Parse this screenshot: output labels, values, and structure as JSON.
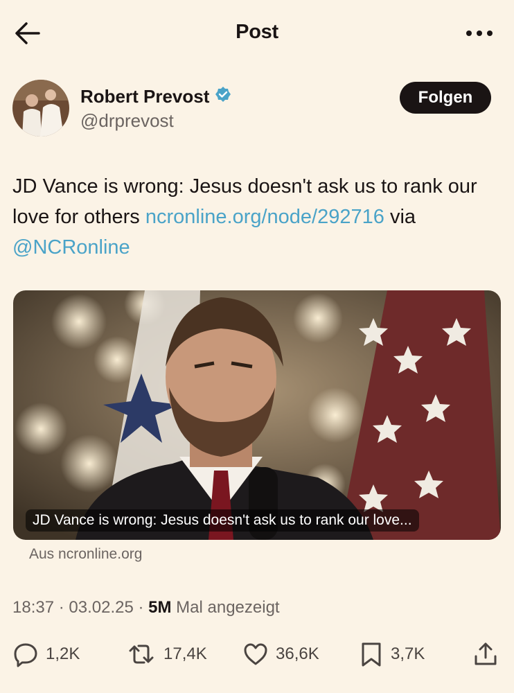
{
  "header": {
    "title": "Post",
    "back_icon": "back-arrow-icon",
    "more_icon": "more-dots-icon"
  },
  "author": {
    "name": "Robert Prevost",
    "handle": "@drprevost",
    "verified_icon": "verified-badge-icon",
    "follow_label": "Folgen"
  },
  "post": {
    "text_before": "JD Vance is wrong: Jesus doesn't ask us to rank our love for others ",
    "link": "ncronline.org/node/292716",
    "text_mid": " via ",
    "mention": "@NCRonline"
  },
  "card": {
    "caption": "JD Vance is wrong: Jesus doesn't ask us to rank our love...",
    "source": "Aus ncronline.org"
  },
  "meta": {
    "time": "18:37",
    "sep1": " · ",
    "date": "03.02.25",
    "sep2": " · ",
    "views": "5M",
    "views_label": " Mal angezeigt"
  },
  "actions": {
    "replies": "1,2K",
    "reposts": "17,4K",
    "likes": "36,6K",
    "bookmarks": "3,7K"
  },
  "colors": {
    "background": "#fbf3e6",
    "link": "#4aa3c8",
    "verified": "#4aa3c8",
    "button": "#1a1414"
  }
}
